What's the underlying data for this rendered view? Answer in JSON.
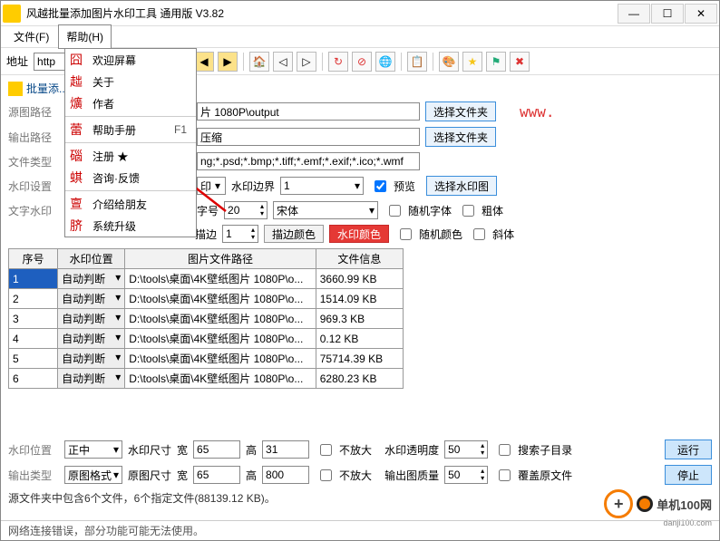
{
  "title": "风越批量添加图片水印工具 通用版 V3.82",
  "menubar": {
    "file": "文件(F)",
    "help": "帮助(H)"
  },
  "help_menu": {
    "welcome": "欢迎屏幕",
    "about": "关于",
    "author": "作者",
    "manual": "帮助手册",
    "manual_accel": "F1",
    "register": "注册",
    "register_star": "★",
    "faq": "咨询·反馈",
    "recommend": "介绍给朋友",
    "upgrade": "系统升级"
  },
  "addrbar": {
    "label": "地址",
    "scheme": "http"
  },
  "section": {
    "batch_title": "批量添..."
  },
  "labels": {
    "src_path": "源图路径",
    "out_path": "输出路径",
    "file_type": "文件类型",
    "wm_setting": "水印设置",
    "text_wm": "文字水印",
    "wm_border": "水印边界",
    "preview": "预览",
    "font_size_lbl": "字号",
    "stroke_lbl": "描边",
    "stroke_color": "描边颜色",
    "wm_color": "水印颜色",
    "rand_font": "随机字体",
    "bold": "粗体",
    "rand_color": "随机颜色",
    "italic": "斜体",
    "wm_pos": "水印位置",
    "wm_size": "水印尺寸",
    "width": "宽",
    "height": "高",
    "no_enlarge": "不放大",
    "wm_opacity": "水印透明度",
    "search_subdir": "搜索子目录",
    "out_type": "输出类型",
    "src_format": "原图格式",
    "src_size": "原图尺寸",
    "out_quality": "输出图质量",
    "overwrite": "覆盖原文件",
    "run": "运行",
    "stop": "停止",
    "select_folder": "选择文件夹",
    "select_wm": "选择水印图",
    "center": "正中"
  },
  "values": {
    "src_path": "片 1080P\\output",
    "out_path": "压缩",
    "file_types": "ng;*.psd;*.bmp;*.tiff;*.emf;*.exif;*.ico;*.wmf",
    "wm_setting_opt": "印",
    "wm_border_val": "1",
    "font_size": "20",
    "font_family": "宋体",
    "stroke_val": "1",
    "w1": "65",
    "h1": "31",
    "opacity": "50",
    "w2": "65",
    "h2": "800",
    "quality": "50"
  },
  "table": {
    "headers": {
      "seq": "序号",
      "pos": "水印位置",
      "path": "图片文件路径",
      "info": "文件信息"
    },
    "rows": [
      {
        "seq": "1",
        "pos": "自动判断",
        "path": "D:\\tools\\桌面\\4K壁纸图片 1080P\\o...",
        "info": "3660.99 KB"
      },
      {
        "seq": "2",
        "pos": "自动判断",
        "path": "D:\\tools\\桌面\\4K壁纸图片 1080P\\o...",
        "info": "1514.09 KB"
      },
      {
        "seq": "3",
        "pos": "自动判断",
        "path": "D:\\tools\\桌面\\4K壁纸图片 1080P\\o...",
        "info": "969.3 KB"
      },
      {
        "seq": "4",
        "pos": "自动判断",
        "path": "D:\\tools\\桌面\\4K壁纸图片 1080P\\o...",
        "info": "0.12 KB"
      },
      {
        "seq": "5",
        "pos": "自动判断",
        "path": "D:\\tools\\桌面\\4K壁纸图片 1080P\\o...",
        "info": "75714.39 KB"
      },
      {
        "seq": "6",
        "pos": "自动判断",
        "path": "D:\\tools\\桌面\\4K壁纸图片 1080P\\o...",
        "info": "6280.23 KB"
      }
    ]
  },
  "summary": "源文件夹中包含6个文件，6个指定文件(88139.12 KB)。",
  "status": "网络连接错误，部分功能可能无法使用。",
  "www": "www.",
  "logo": {
    "brand": "单机100网",
    "sub": "danji100.com"
  }
}
